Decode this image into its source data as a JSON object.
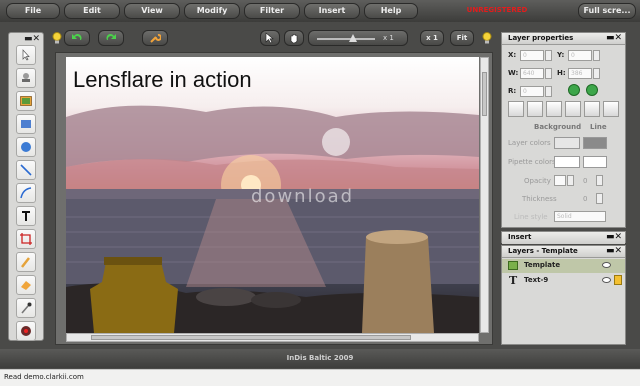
{
  "menu": {
    "items": [
      "File",
      "Edit",
      "View",
      "Modify",
      "Filter",
      "Insert",
      "Help"
    ],
    "unregistered": "UNREGISTERED",
    "fullscreen": "Full scre..."
  },
  "toolbar": {
    "zoom_level": "x 1",
    "zoom_button": "x 1",
    "fit_button": "Fit"
  },
  "canvas": {
    "title_text": "Lensflare in action",
    "watermark": "download"
  },
  "layer_properties": {
    "title": "Layer properties",
    "x_label": "X:",
    "y_label": "Y:",
    "w_label": "W:",
    "h_label": "H:",
    "r_label": "R:",
    "w_value": "640",
    "h_value": "386",
    "x_value": "0",
    "y_value": "0",
    "r_value": "0",
    "background_label": "Background",
    "line_label": "Line",
    "layer_colors_label": "Layer colors",
    "pipette_colors_label": "Pipette colors",
    "opacity_label": "Opacity",
    "opacity_value": "0",
    "thickness_label": "Thickness",
    "thickness_value": "0",
    "line_style_label": "Line style",
    "line_style_value": "Solid"
  },
  "insert_panel": {
    "title": "Insert"
  },
  "layers_panel": {
    "title": "Layers - Template",
    "items": [
      {
        "name": "Template",
        "icon": "image-icon"
      },
      {
        "name": "Text-9",
        "icon": "text-icon"
      }
    ]
  },
  "footer": {
    "text": "InDis Baltic  2009"
  },
  "status": {
    "text": "Read demo.clarkii.com"
  }
}
